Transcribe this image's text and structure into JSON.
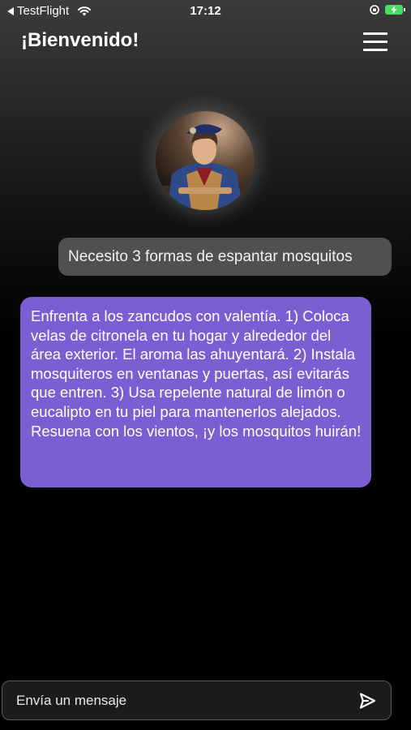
{
  "status_bar": {
    "back_app": "TestFlight",
    "time": "17:12"
  },
  "header": {
    "title": "¡Bienvenido!"
  },
  "chat": {
    "messages": [
      {
        "role": "user",
        "text": "Necesito 3 formas de espantar mosquitos"
      },
      {
        "role": "assistant",
        "text": "Enfrenta a los zancudos con valentía. 1) Coloca velas de citronela en tu hogar y alrededor del área exterior. El aroma las ahuyentará. 2) Instala mosquiteros en ventanas y puertas, así evitarás que entren. 3) Usa repelente natural de limón o eucalipto en tu piel para mantenerlos alejados. Resuena con los vientos, ¡y los mosquitos huirán!"
      }
    ]
  },
  "input": {
    "placeholder": "Envía un mensaje"
  },
  "colors": {
    "assistant_bubble": "#7b5fd2",
    "user_bubble": "#505050",
    "battery_charging": "#4cd964"
  },
  "icons": {
    "menu": "hamburger-menu-icon",
    "send": "send-icon",
    "wifi": "wifi-icon",
    "battery": "battery-charging-icon",
    "orientation_lock": "orientation-lock-icon"
  }
}
